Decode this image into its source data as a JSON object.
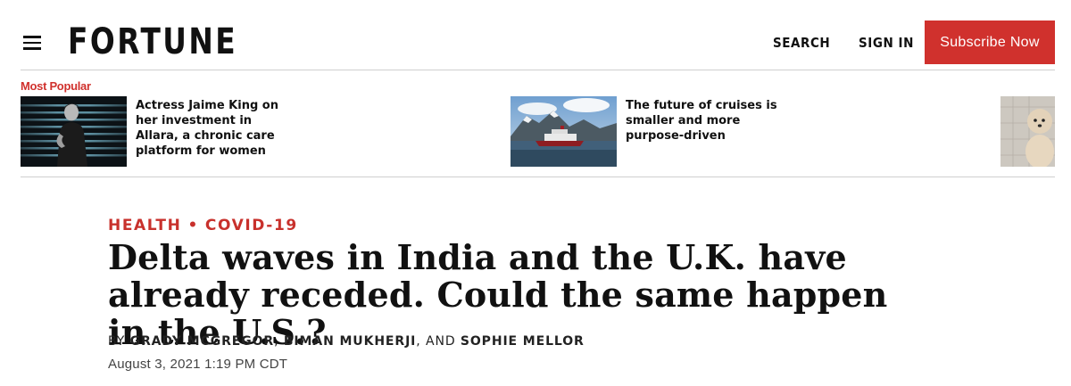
{
  "header": {
    "logo": "FORTUNE",
    "search_label": "SEARCH",
    "signin_label": "SIGN IN",
    "subscribe_label": "Subscribe Now",
    "subscribe_color": "#d0312d"
  },
  "most_popular": {
    "label": "Most Popular",
    "items": [
      {
        "title": "Actress Jaime King on her investment in Allara, a chronic care platform for women",
        "thumbnail": "portrait-photo"
      },
      {
        "title": "The future of cruises is smaller and more purpose-driven",
        "thumbnail": "cruise-ship-photo"
      },
      {
        "title": "",
        "thumbnail": "dog-photo"
      }
    ]
  },
  "article": {
    "category": "HEALTH",
    "subcategory": "COVID-19",
    "category_separator": "•",
    "headline": "Delta waves in India and the U.K. have already receded. Could the same happen in the U.S.?",
    "byline_prefix": "BY",
    "authors": [
      "GRADY MCGREGOR",
      "BIMAN MUKHERJI",
      "SOPHIE MELLOR"
    ],
    "author_sep_1": ",",
    "author_sep_2": ", AND",
    "date": "August 3, 2021 1:19 PM CDT"
  }
}
